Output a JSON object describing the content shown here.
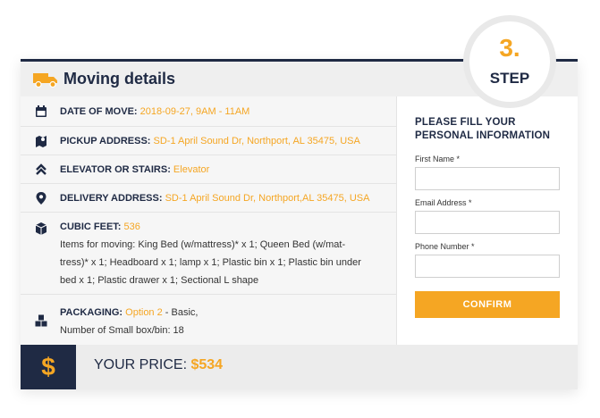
{
  "header": {
    "title": "Moving details"
  },
  "step": {
    "number": "3.",
    "label": "STEP"
  },
  "details": {
    "date": {
      "label": "DATE OF MOVE:",
      "value": "2018-09-27, 9AM - 11AM"
    },
    "pickup": {
      "label": "PICKUP ADDRESS:",
      "value": "SD-1 April Sound Dr, Northport, AL 35475, USA"
    },
    "elevator": {
      "label": "ELEVATOR OR STAIRS:",
      "value": "Elevator"
    },
    "delivery": {
      "label": "DELIVERY ADDRESS:",
      "value": "SD-1 April Sound Dr, Northport,AL 35475, USA"
    },
    "cubic": {
      "label": "CUBIC FEET:",
      "value": "536",
      "items_line1": "Items for moving: King Bed (w/mattress)* x 1; Queen Bed (w/mat-",
      "items_line2": "tress)* x 1; Headboard x 1; lamp x 1; Plastic bin x 1; Plastic bin under",
      "items_line3": "bed x 1; Plastic drawer x 1; Sectional L shape"
    },
    "packaging": {
      "label": "PACKAGING:",
      "value": "Option 2",
      "suffix": " - Basic,",
      "line2": "Number of Small box/bin: 18"
    }
  },
  "form": {
    "heading_line1": "PLEASE FILL YOUR",
    "heading_line2": "PERSONAL INFORMATION",
    "first_name_label": "First Name *",
    "first_name_value": "",
    "email_label": "Email Address *",
    "email_value": "",
    "phone_label": "Phone Number *",
    "phone_value": "",
    "confirm_label": "CONFIRM"
  },
  "footer": {
    "price_label": "YOUR PRICE: ",
    "price_value": "$534",
    "currency_symbol": "$"
  },
  "colors": {
    "navy": "#1f2a44",
    "accent": "#f5a623"
  },
  "icons": [
    "truck-icon",
    "calendar-icon",
    "map-icon",
    "chevrons-up-icon",
    "location-pin-icon",
    "box-icon",
    "boxes-icon",
    "dollar-icon"
  ]
}
